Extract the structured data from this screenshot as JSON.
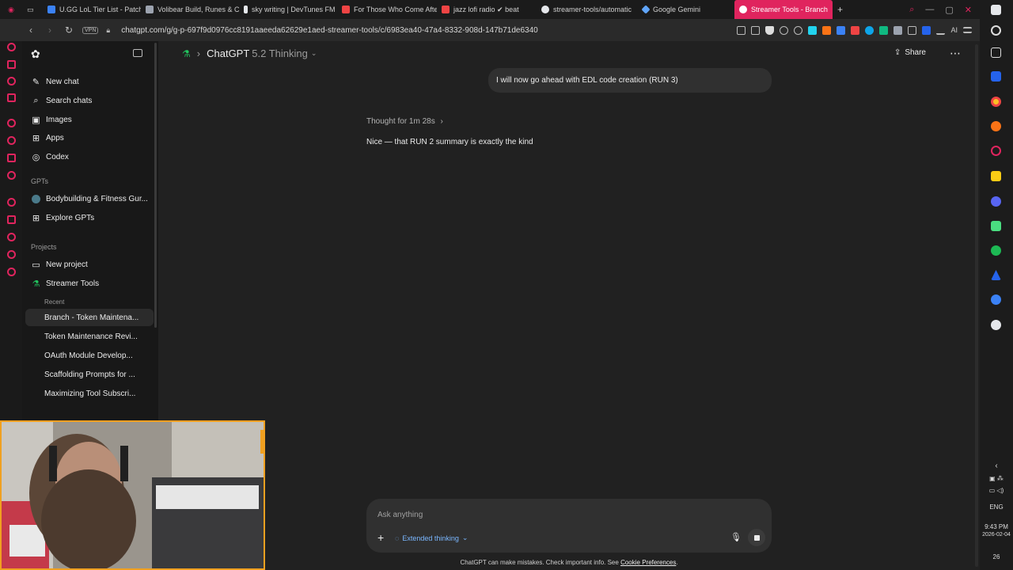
{
  "browser": {
    "tabs": [
      {
        "label": "U.GG LoL Tier List - Patch",
        "color": "#3b82f6"
      },
      {
        "label": "Volibear Build, Runes & C",
        "color": "#9ca3af"
      },
      {
        "label": "sky writing | DevTunes FM",
        "color": "#e5e7eb"
      },
      {
        "label": "For Those Who Come Afte",
        "color": "#ef4444"
      },
      {
        "label": "jazz lofi radio ✔ beat",
        "color": "#ef4444"
      },
      {
        "label": "streamer-tools/automatic",
        "color": "#e5e7eb"
      },
      {
        "label": "Google Gemini",
        "color": "#60a5fa"
      },
      {
        "label": "Streamer Tools - Branch",
        "color": "#ffffff"
      }
    ],
    "vpn_label": "VPN",
    "url": "chatgpt.com/g/g-p-697f9d0976cc8191aaeeda62629e1aed-streamer-tools/c/6983ea40-47a4-8332-908d-147b71de6340",
    "ai_label": "AI",
    "accent_color": "#e0245e"
  },
  "sidebar": {
    "nav": [
      {
        "label": "New chat",
        "icon": "edit-icon"
      },
      {
        "label": "Search chats",
        "icon": "search-icon"
      },
      {
        "label": "Images",
        "icon": "image-icon"
      },
      {
        "label": "Apps",
        "icon": "apps-icon"
      },
      {
        "label": "Codex",
        "icon": "codex-icon"
      }
    ],
    "gpts_heading": "GPTs",
    "gpts": [
      {
        "label": "Bodybuilding & Fitness Gur...",
        "icon": "gpt-avatar-icon"
      },
      {
        "label": "Explore GPTs",
        "icon": "grid-icon"
      }
    ],
    "projects_heading": "Projects",
    "projects": [
      {
        "label": "New project",
        "icon": "folder-plus-icon"
      },
      {
        "label": "Streamer Tools",
        "icon": "flask-icon"
      }
    ],
    "recent_heading": "Recent",
    "recent": [
      {
        "label": "Branch - Token Maintena...",
        "selected": true
      },
      {
        "label": "Token Maintenance Revi...",
        "selected": false
      },
      {
        "label": "OAuth Module Develop...",
        "selected": false
      },
      {
        "label": "Scaffolding Prompts for ...",
        "selected": false
      },
      {
        "label": "Maximizing Tool Subscri...",
        "selected": false
      }
    ]
  },
  "main": {
    "model_name": "ChatGPT",
    "model_version": "5.2 Thinking",
    "share_label": "Share",
    "user_message": "I will now go ahead with EDL code creation (RUN 3)",
    "thought_label": "Thought for 1m 28s",
    "reply_text": "Nice — that RUN 2 summary is exactly the kind",
    "composer": {
      "placeholder": "Ask anything",
      "mode_label": "Extended thinking"
    },
    "disclaimer": "ChatGPT can make mistakes. Check important info. See",
    "disclaimer_link": "Cookie Preferences",
    "disclaimer_end": "."
  },
  "taskbar": {
    "language": "ENG",
    "time": "9:43 PM",
    "date": "2026-02-04",
    "badge": "26"
  }
}
